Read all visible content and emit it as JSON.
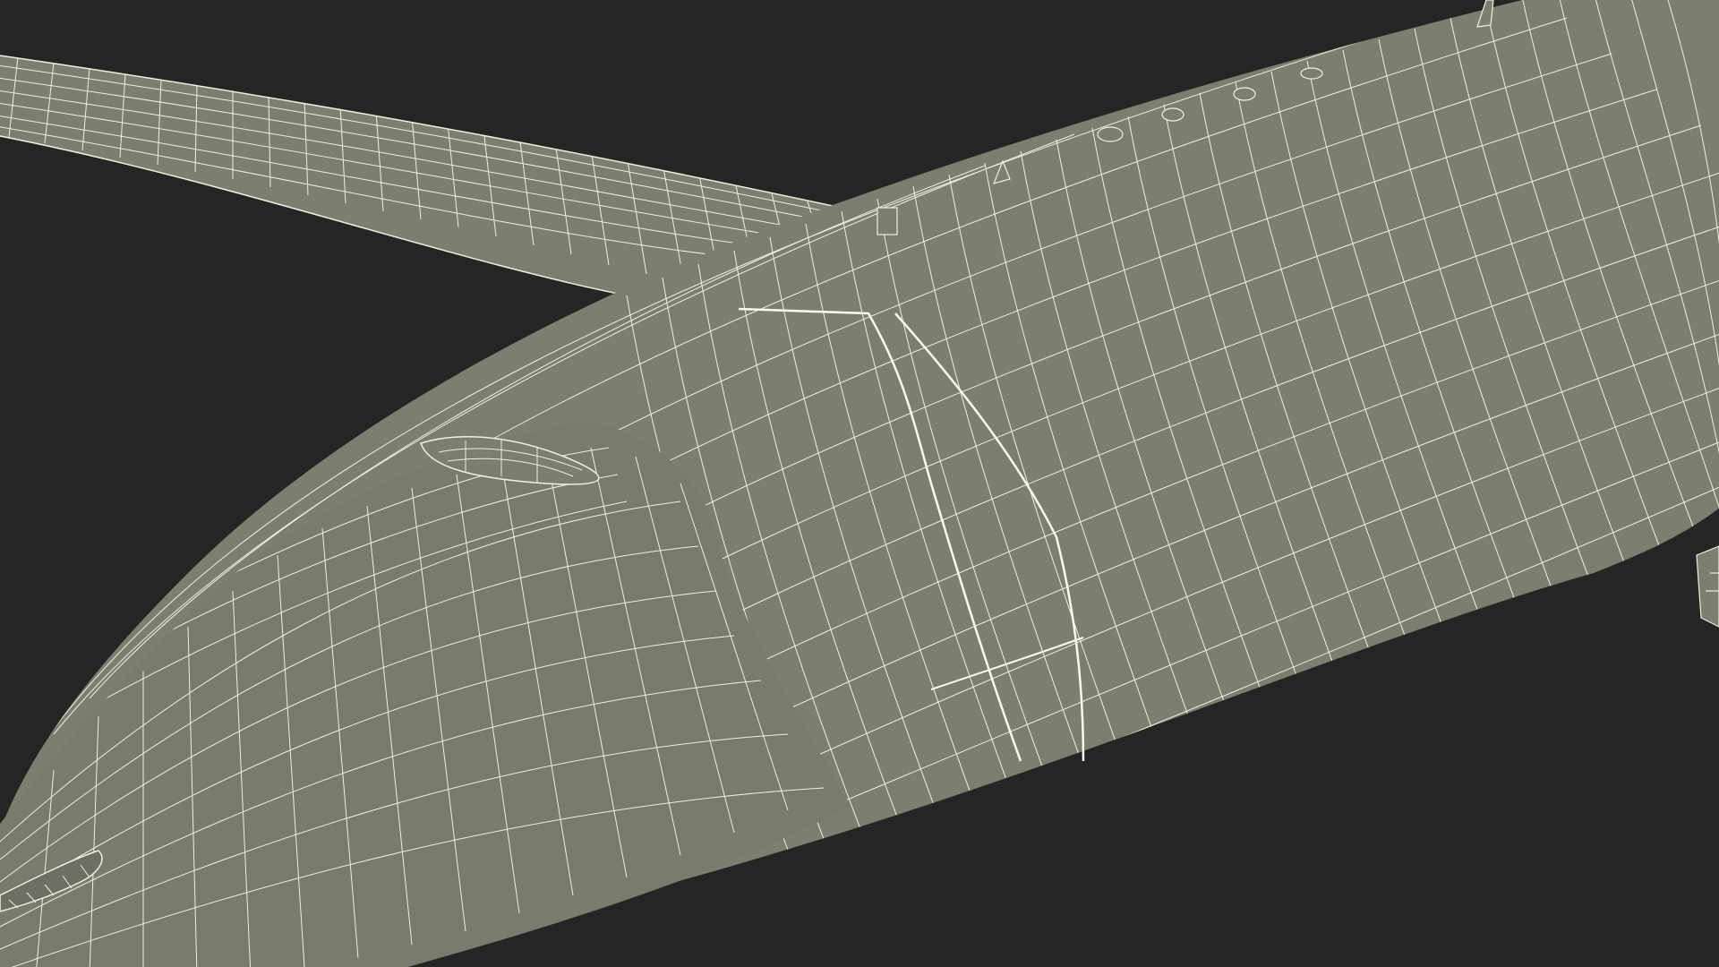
{
  "scene": {
    "subject": "wireframe-aircraft-fuselage",
    "background_color": "#252525",
    "surface_color": "#7d7e70",
    "surface_shadow_color": "#6e6f62",
    "wire_color": "#f0f0de",
    "seam_color": "#fbfbe8"
  }
}
